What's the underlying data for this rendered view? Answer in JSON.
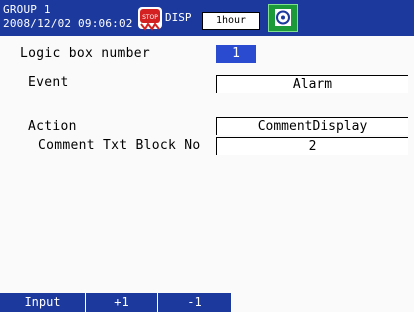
{
  "header": {
    "group": "GROUP 1",
    "datetime": "2008/12/02 09:06:02",
    "stop_icon_label": "STOP",
    "display_label": "DISP",
    "interval": "1hour",
    "media_icon": "media-card-icon"
  },
  "form": {
    "logic_box": {
      "label": "Logic box number",
      "value": "1"
    },
    "event": {
      "label": "Event",
      "value": "Alarm"
    },
    "action": {
      "label": "Action",
      "value": "CommentDisplay"
    },
    "comment_block": {
      "label": "Comment Txt Block No",
      "value": "2"
    }
  },
  "softkeys": [
    {
      "label": "Input"
    },
    {
      "label": "+1"
    },
    {
      "label": "-1"
    }
  ],
  "colors": {
    "header_bg": "#1c3a9e",
    "selected_bg": "#2a4bd0",
    "media_icon_bg": "#1c9a3a",
    "stop_icon": "#d42020"
  }
}
